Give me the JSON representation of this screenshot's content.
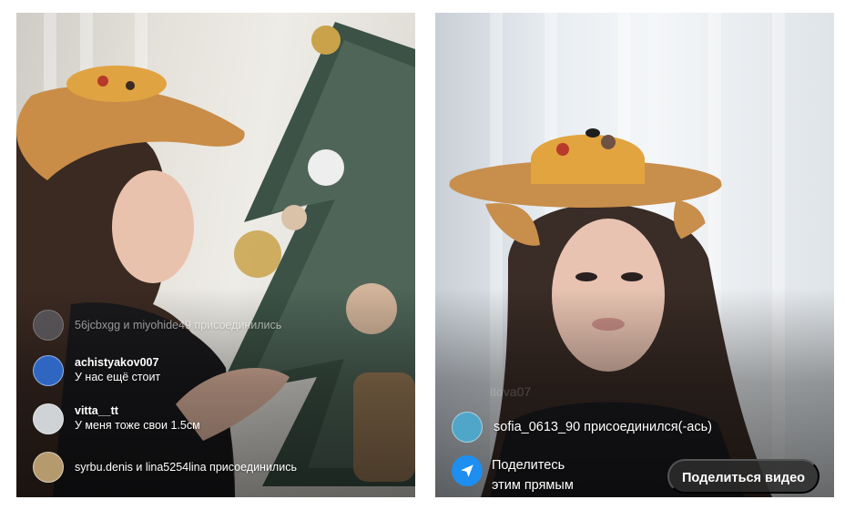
{
  "left_stream": {
    "comments": [
      {
        "type": "system",
        "text": "56jcbxgg и miyohide49 присоединились",
        "avatar_color": "#6f7481"
      },
      {
        "type": "comment",
        "user": "achistyakov007",
        "message": "У нас ещё стоит",
        "avatar_color": "#2f66c2"
      },
      {
        "type": "comment",
        "user": "vitta__tt",
        "message": "У меня тоже свои 1.5см",
        "avatar_color": "#cfd3d6"
      },
      {
        "type": "system",
        "text": "syrbu.denis и lina5254lina присоединились",
        "avatar_color": "#b59a6e"
      }
    ]
  },
  "right_stream": {
    "watermark": "itova07",
    "joined": {
      "text": "sofia_0613_90 присоединился(-ась)",
      "avatar_color": "#4fa6c9"
    },
    "share_prompt": {
      "line1": "Поделитесь",
      "line2": "этим прямым",
      "icon": "send-icon",
      "icon_color": "#1e8ef0"
    },
    "share_video_button": "Поделиться видео"
  }
}
